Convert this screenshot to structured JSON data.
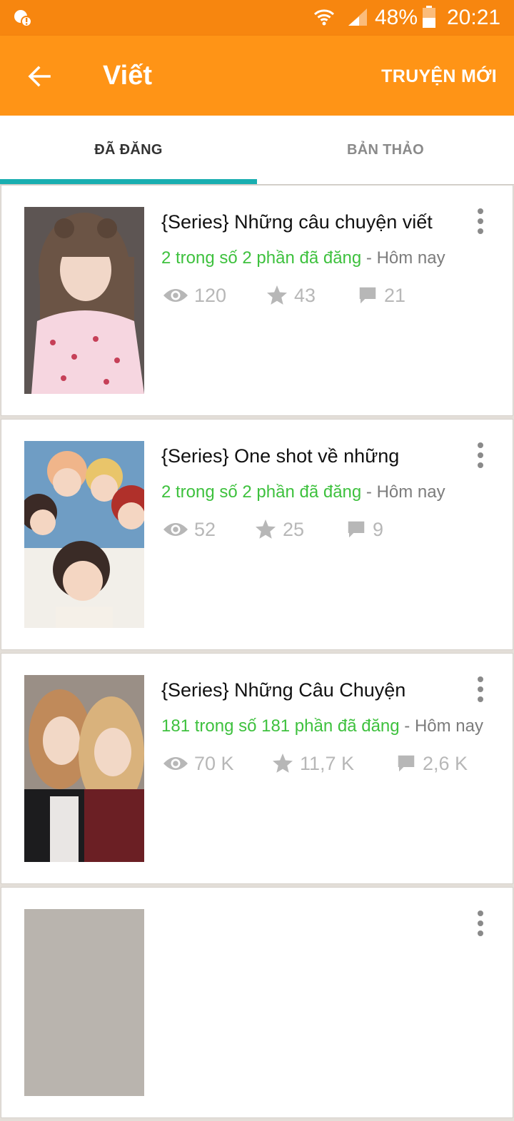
{
  "status_bar": {
    "battery": "48%",
    "time": "20:21"
  },
  "app_bar": {
    "title": "Viết",
    "new_story": "TRUYỆN MỚI"
  },
  "tabs": [
    {
      "label": "ĐÃ ĐĂNG",
      "selected": true
    },
    {
      "label": "BẢN THẢO",
      "selected": false
    }
  ],
  "stories": [
    {
      "title": "{Series} Những câu chuyện viết",
      "parts": "2 trong số 2 phần đã đăng",
      "separator": " - ",
      "date": "Hôm nay",
      "views": "120",
      "votes": "43",
      "comments": "21"
    },
    {
      "title": "{Series} One shot về những",
      "parts": "2 trong số 2 phần đã đăng",
      "separator": " - ",
      "date": "Hôm nay",
      "views": "52",
      "votes": "25",
      "comments": "9"
    },
    {
      "title": "{Series} Những Câu Chuyện",
      "parts": "181 trong số 181 phần đã đăng",
      "separator": " - ",
      "date": "Hôm nay",
      "views": "70 K",
      "votes": "11,7 K",
      "comments": "2,6 K"
    }
  ],
  "colors": {
    "status_bar": "#f7860f",
    "app_bar": "#ff9416",
    "tab_indicator": "#19aeb0",
    "parts_green": "#3ec13e"
  }
}
